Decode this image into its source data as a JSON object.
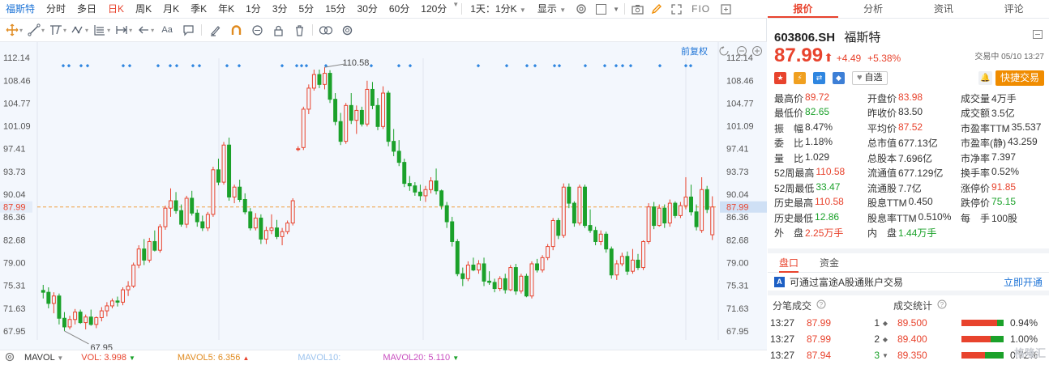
{
  "topbar": {
    "stock_tab": "福斯特",
    "tabs": [
      "分时",
      "多日",
      "日K",
      "周K",
      "月K",
      "季K",
      "年K",
      "1分",
      "3分",
      "5分",
      "15分",
      "30分",
      "60分",
      "120分"
    ],
    "active_tab": "日K",
    "multi_period": "1天：1分K",
    "display": "显示",
    "fio": "FIO"
  },
  "toolbar": {
    "aa_label": "Aa"
  },
  "chart": {
    "adjust_label": "前复权",
    "current_price_label": "87.99",
    "high_mark": "110.58",
    "low_mark": "67.95",
    "left_ticks": [
      "112.14",
      "108.46",
      "104.77",
      "101.09",
      "97.41",
      "93.73",
      "90.04",
      "87.99",
      "86.36",
      "82.68",
      "79.00",
      "75.31",
      "71.63",
      "67.95"
    ],
    "right_ticks": [
      "112.14",
      "108.46",
      "104.77",
      "101.09",
      "97.41",
      "93.73",
      "90.04",
      "87.99",
      "86.36",
      "82.68",
      "79.00",
      "75.31",
      "71.63",
      "67.95"
    ]
  },
  "chart_data": {
    "type": "candlestick",
    "ylim": [
      66.5,
      113.6
    ],
    "yticks": [
      112.14,
      108.46,
      104.77,
      101.09,
      97.41,
      93.73,
      90.04,
      86.36,
      82.68,
      79.0,
      75.31,
      71.63,
      67.95
    ],
    "last_price": 87.99,
    "high": 110.58,
    "low": 67.95,
    "candles": [
      [
        74.5,
        75.4,
        73.2,
        74.2
      ],
      [
        74.2,
        75.0,
        71.6,
        72.4
      ],
      [
        72.4,
        74.2,
        70.8,
        73.6
      ],
      [
        73.6,
        74.0,
        69.0,
        70.0
      ],
      [
        70.0,
        71.0,
        67.95,
        68.6
      ],
      [
        68.6,
        70.4,
        68.2,
        69.8
      ],
      [
        69.8,
        71.5,
        69.0,
        71.0
      ],
      [
        71.0,
        71.4,
        69.1,
        69.3
      ],
      [
        69.3,
        70.6,
        68.2,
        70.2
      ],
      [
        70.2,
        71.4,
        68.8,
        69.0
      ],
      [
        69.0,
        70.3,
        68.4,
        70.1
      ],
      [
        70.1,
        71.8,
        69.5,
        71.2
      ],
      [
        71.2,
        72.6,
        70.3,
        72.0
      ],
      [
        72.0,
        73.2,
        71.6,
        72.8
      ],
      [
        72.8,
        73.5,
        71.9,
        72.6
      ],
      [
        72.6,
        75.0,
        72.1,
        74.6
      ],
      [
        74.6,
        76.0,
        73.6,
        75.2
      ],
      [
        75.2,
        79.0,
        74.9,
        78.6
      ],
      [
        78.6,
        81.8,
        78.1,
        81.2
      ],
      [
        81.2,
        82.8,
        78.6,
        79.4
      ],
      [
        79.4,
        83.0,
        79.0,
        82.4
      ],
      [
        82.4,
        84.2,
        80.8,
        81.0
      ],
      [
        81.0,
        85.2,
        80.6,
        84.8
      ],
      [
        84.8,
        88.2,
        84.3,
        87.8
      ],
      [
        87.8,
        91.0,
        86.4,
        89.0
      ],
      [
        89.0,
        90.4,
        86.9,
        87.4
      ],
      [
        87.4,
        88.4,
        84.8,
        85.2
      ],
      [
        85.2,
        89.8,
        84.6,
        89.4
      ],
      [
        89.4,
        90.6,
        86.6,
        87.0
      ],
      [
        87.0,
        87.6,
        84.8,
        85.6
      ],
      [
        85.6,
        86.6,
        84.1,
        84.6
      ],
      [
        84.6,
        87.2,
        84.1,
        86.8
      ],
      [
        86.8,
        94.5,
        86.4,
        94.0
      ],
      [
        94.0,
        95.8,
        91.5,
        92.0
      ],
      [
        92.0,
        98.5,
        91.6,
        98.0
      ],
      [
        98.0,
        99.2,
        89.0,
        89.6
      ],
      [
        89.6,
        91.6,
        88.6,
        91.2
      ],
      [
        91.2,
        92.4,
        88.8,
        89.2
      ],
      [
        89.2,
        90.2,
        86.8,
        87.2
      ],
      [
        87.2,
        87.8,
        84.2,
        84.6
      ],
      [
        84.6,
        87.0,
        84.2,
        86.2
      ],
      [
        86.2,
        86.8,
        82.0,
        82.8
      ],
      [
        82.8,
        84.8,
        82.0,
        84.2
      ],
      [
        84.2,
        86.8,
        83.6,
        84.6
      ],
      [
        84.6,
        85.9,
        82.8,
        83.2
      ],
      [
        83.2,
        84.6,
        81.8,
        84.0
      ],
      [
        84.0,
        85.8,
        83.6,
        85.4
      ],
      [
        85.4,
        89.4,
        85.0,
        89.0
      ],
      [
        97.4,
        97.8,
        97.0,
        97.4
      ],
      [
        97.6,
        104.2,
        97.2,
        103.8
      ],
      [
        103.8,
        107.8,
        103.0,
        107.2
      ],
      [
        107.2,
        110.2,
        106.8,
        109.4
      ],
      [
        109.4,
        110.2,
        107.2,
        107.8
      ],
      [
        107.8,
        110.58,
        107.0,
        109.6
      ],
      [
        109.6,
        110.1,
        104.8,
        105.4
      ],
      [
        105.4,
        106.4,
        101.2,
        101.8
      ],
      [
        101.8,
        103.2,
        98.0,
        98.6
      ],
      [
        98.6,
        104.8,
        98.2,
        104.4
      ],
      [
        104.4,
        106.4,
        101.4,
        102.0
      ],
      [
        102.0,
        104.4,
        99.8,
        103.6
      ],
      [
        103.6,
        104.2,
        101.0,
        101.4
      ],
      [
        101.4,
        108.4,
        101.0,
        107.0
      ],
      [
        107.0,
        108.2,
        103.8,
        104.4
      ],
      [
        104.4,
        105.6,
        100.4,
        101.0
      ],
      [
        101.0,
        107.5,
        100.6,
        106.4
      ],
      [
        106.4,
        106.8,
        97.8,
        98.6
      ],
      [
        98.6,
        100.6,
        96.2,
        97.0
      ],
      [
        97.0,
        98.8,
        94.6,
        95.2
      ],
      [
        95.2,
        95.8,
        91.2,
        91.8
      ],
      [
        91.8,
        93.0,
        90.6,
        91.4
      ],
      [
        91.4,
        92.0,
        89.8,
        90.4
      ],
      [
        90.4,
        91.6,
        89.0,
        89.8
      ],
      [
        89.8,
        91.4,
        88.8,
        90.8
      ],
      [
        90.8,
        92.8,
        90.2,
        92.2
      ],
      [
        92.2,
        94.2,
        90.0,
        90.6
      ],
      [
        90.6,
        90.8,
        87.6,
        88.2
      ],
      [
        88.2,
        88.8,
        84.6,
        85.6
      ],
      [
        85.6,
        86.4,
        81.6,
        82.4
      ],
      [
        82.4,
        82.8,
        76.8,
        77.2
      ],
      [
        77.2,
        78.2,
        75.2,
        76.4
      ],
      [
        76.4,
        79.2,
        76.0,
        78.6
      ],
      [
        78.6,
        79.8,
        77.6,
        77.8
      ],
      [
        77.8,
        79.4,
        77.2,
        78.8
      ],
      [
        78.8,
        79.8,
        75.2,
        76.0
      ],
      [
        76.0,
        77.6,
        75.4,
        75.8
      ],
      [
        75.8,
        76.4,
        74.2,
        74.8
      ],
      [
        74.8,
        76.8,
        74.4,
        76.4
      ],
      [
        76.4,
        77.2,
        74.0,
        74.6
      ],
      [
        74.6,
        78.6,
        74.4,
        78.2
      ],
      [
        78.2,
        78.8,
        73.8,
        74.4
      ],
      [
        74.4,
        77.2,
        74.0,
        76.8
      ],
      [
        76.8,
        77.2,
        73.4,
        73.6
      ],
      [
        73.6,
        79.2,
        73.2,
        78.8
      ],
      [
        78.8,
        79.6,
        77.4,
        77.8
      ],
      [
        77.8,
        80.2,
        77.4,
        79.8
      ],
      [
        79.8,
        82.0,
        79.4,
        81.6
      ],
      [
        81.6,
        86.2,
        81.0,
        85.8
      ],
      [
        85.8,
        86.2,
        82.8,
        83.4
      ],
      [
        83.4,
        91.8,
        83.0,
        91.2
      ],
      [
        91.2,
        91.8,
        87.8,
        88.6
      ],
      [
        88.6,
        88.9,
        84.8,
        85.4
      ],
      [
        85.4,
        91.6,
        85.0,
        91.2
      ],
      [
        91.2,
        91.6,
        84.6,
        85.0
      ],
      [
        85.0,
        87.6,
        83.8,
        84.2
      ],
      [
        84.2,
        84.8,
        81.8,
        82.4
      ],
      [
        82.4,
        84.2,
        81.8,
        83.6
      ],
      [
        83.6,
        84.0,
        80.6,
        81.2
      ],
      [
        81.2,
        81.6,
        76.4,
        77.0
      ],
      [
        77.0,
        79.4,
        76.2,
        78.8
      ],
      [
        78.8,
        80.6,
        78.4,
        80.0
      ],
      [
        80.0,
        80.8,
        77.0,
        77.6
      ],
      [
        77.6,
        81.2,
        77.2,
        79.4
      ],
      [
        79.4,
        80.4,
        77.8,
        78.2
      ],
      [
        78.2,
        82.6,
        77.8,
        82.4
      ],
      [
        82.4,
        88.6,
        82.0,
        88.0
      ],
      [
        88.0,
        88.8,
        84.4,
        85.0
      ],
      [
        85.0,
        88.4,
        84.8,
        87.8
      ],
      [
        87.8,
        88.4,
        84.6,
        85.4
      ],
      [
        85.4,
        89.2,
        84.8,
        88.6
      ],
      [
        88.6,
        88.9,
        86.2,
        86.6
      ],
      [
        86.6,
        88.8,
        86.2,
        88.2
      ],
      [
        88.2,
        92.8,
        87.6,
        89.6
      ],
      [
        89.6,
        91.6,
        86.6,
        87.2
      ],
      [
        87.2,
        88.4,
        84.2,
        84.8
      ],
      [
        84.2,
        92.8,
        83.8,
        90.8
      ],
      [
        90.8,
        91.4,
        87.0,
        87.6
      ],
      [
        83.5,
        89.72,
        82.65,
        87.99
      ]
    ]
  },
  "bottom": {
    "indicator": "MAVOL",
    "vol": "VOL: 3.998",
    "mavol5": "MAVOL5: 6.356",
    "mavol10": "MAVOL10:",
    "mavol20": "MAVOL20: 5.110"
  },
  "right": {
    "tabs": [
      "报价",
      "分析",
      "资讯",
      "评论"
    ],
    "active_tab": "报价",
    "code": "603806.SH",
    "name": "福斯特",
    "price": "87.99",
    "change": "+4.49",
    "change_pct": "+5.38%",
    "status": "交易中 05/10 13:27",
    "fav": "自选",
    "quick_trade": "快捷交易",
    "quote_grid": [
      [
        [
          "最高价",
          "89.72",
          "red"
        ],
        [
          "开盘价",
          "83.98",
          "red"
        ],
        [
          "成交量",
          "4万手",
          "blk"
        ]
      ],
      [
        [
          "最低价",
          "82.65",
          "green"
        ],
        [
          "昨收价",
          "83.50",
          "blk"
        ],
        [
          "成交额",
          "3.5亿",
          "blk"
        ]
      ],
      [
        [
          "振　幅",
          "8.47%",
          "blk"
        ],
        [
          "平均价",
          "87.52",
          "red"
        ],
        [
          "市盈率TTM",
          "35.537",
          "blk"
        ]
      ],
      [
        [
          "委　比",
          "1.18%",
          "blk"
        ],
        [
          "总市值",
          "677.13亿",
          "blk"
        ],
        [
          "市盈率(静)",
          "43.259",
          "blk"
        ]
      ],
      [
        [
          "量　比",
          "1.029",
          "blk"
        ],
        [
          "总股本",
          "7.696亿",
          "blk"
        ],
        [
          "市净率",
          "7.397",
          "blk"
        ]
      ],
      [
        [
          "52周最高",
          "110.58",
          "red"
        ],
        [
          "流通值",
          "677.129亿",
          "blk"
        ],
        [
          "换手率",
          "0.52%",
          "blk"
        ]
      ],
      [
        [
          "52周最低",
          "33.47",
          "green"
        ],
        [
          "流通股",
          "7.7亿",
          "blk"
        ],
        [
          "涨停价",
          "91.85",
          "red"
        ]
      ],
      [
        [
          "历史最高",
          "110.58",
          "red"
        ],
        [
          "股息TTM",
          "0.450",
          "blk"
        ],
        [
          "跌停价",
          "75.15",
          "green"
        ]
      ],
      [
        [
          "历史最低",
          "12.86",
          "green"
        ],
        [
          "股息率TTM",
          "0.510%",
          "blk"
        ],
        [
          "每　手",
          "100股",
          "blk"
        ]
      ],
      [
        [
          "外　盘",
          "2.25万手",
          "red"
        ],
        [
          "内　盘",
          "1.44万手",
          "green"
        ]
      ]
    ],
    "fund_tabs": [
      "盘口",
      "资金"
    ],
    "notice": "可通过富途A股通账户交易",
    "notice_link": "立即开通",
    "trades_header": "分笔成交",
    "stats_header": "成交统计",
    "trades": [
      {
        "time": "13:27",
        "price": "87.99",
        "num": "1"
      },
      {
        "time": "13:27",
        "price": "87.99",
        "num": "2"
      },
      {
        "time": "13:27",
        "price": "87.94",
        "num": "3"
      }
    ],
    "stats": [
      {
        "price": "89.500",
        "pct": "0.94%",
        "red": 0.85
      },
      {
        "price": "89.400",
        "pct": "1.00%",
        "red": 0.7
      },
      {
        "price": "89.350",
        "pct": "0.72%",
        "red": 0.55
      }
    ],
    "watermark": "格隆汇"
  }
}
